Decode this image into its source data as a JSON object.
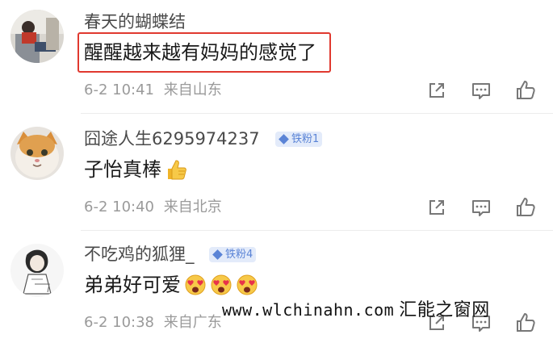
{
  "comments": [
    {
      "username": "春天的蝴蝶结",
      "badge": "",
      "text": "醒醒越来越有妈妈的感觉了",
      "emojis": [],
      "timestamp": "6-2 10:41",
      "location": "来自山东",
      "highlighted": true
    },
    {
      "username": "囧途人生6295974237",
      "badge": "铁粉1",
      "text": "子怡真棒",
      "emojis": [
        "thumbs-up"
      ],
      "timestamp": "6-2 10:40",
      "location": "来自北京",
      "highlighted": false
    },
    {
      "username": "不吃鸡的狐狸_",
      "badge": "铁粉4",
      "text": "弟弟好可爱",
      "emojis": [
        "heart-eyes",
        "heart-eyes",
        "heart-eyes"
      ],
      "timestamp": "6-2 10:38",
      "location": "来自广东",
      "highlighted": false
    }
  ],
  "actions": [
    "share-icon",
    "comment-icon",
    "like-icon"
  ],
  "watermark": {
    "url": "www.wlchinahn.com",
    "site": "汇能之窗网"
  },
  "colors": {
    "highlight_border": "#e0392f",
    "badge_bg": "#e3ebfa",
    "badge_text": "#5b84d6",
    "meta_text": "#9a9a9a"
  }
}
